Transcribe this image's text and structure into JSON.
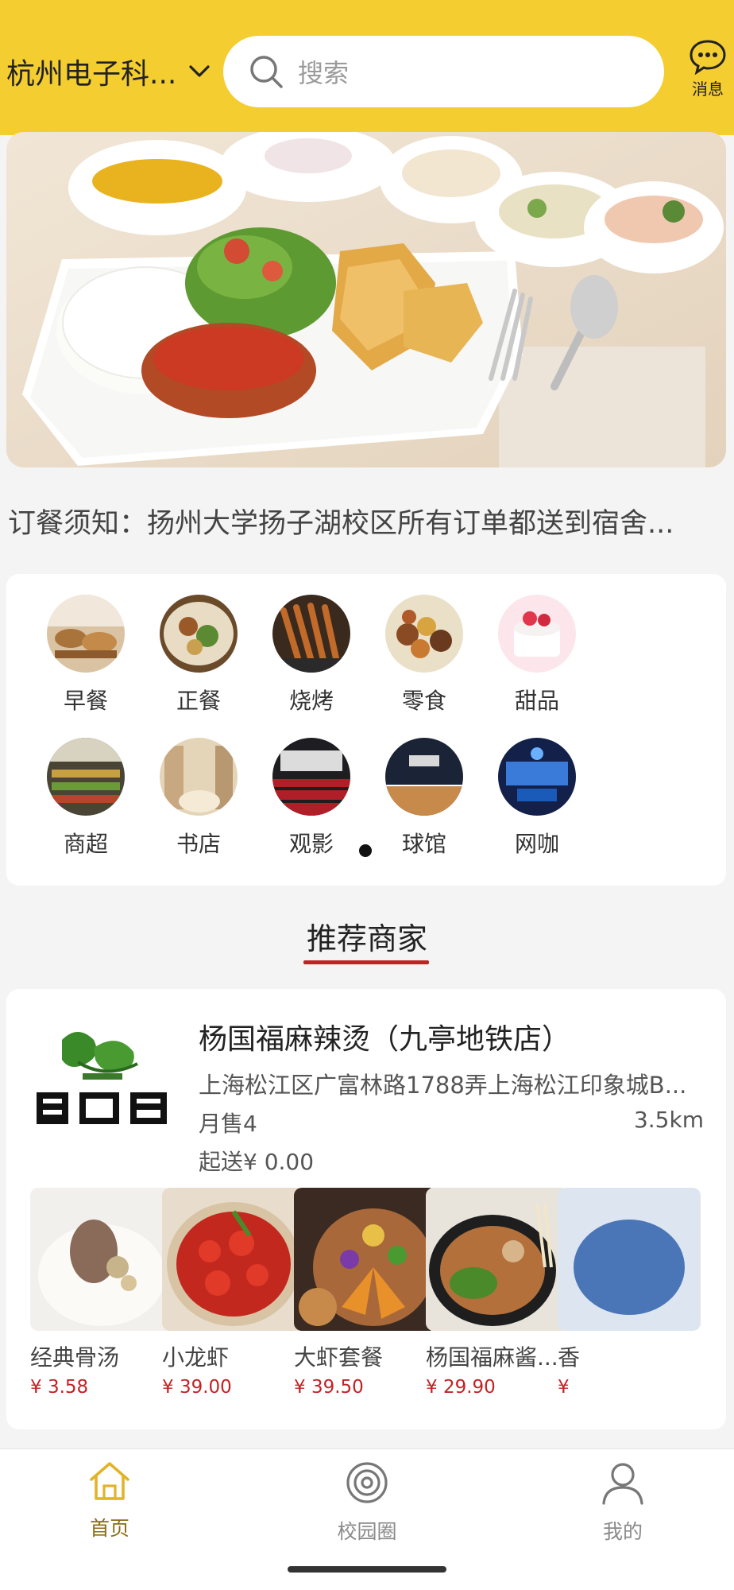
{
  "header": {
    "location": "杭州电子科...",
    "search_placeholder": "搜索",
    "message_label": "消息",
    "icons": [
      "chevron-down-icon",
      "search-icon",
      "chat-bubble-icon"
    ],
    "color": "#f4cd31"
  },
  "notice": "订餐须知：扬州大学扬子湖校区所有订单都送到宿舍...",
  "categories": [
    {
      "label": "早餐",
      "color": "#c89a68"
    },
    {
      "label": "正餐",
      "color": "#8c6a3e"
    },
    {
      "label": "烧烤",
      "color": "#7a4a22"
    },
    {
      "label": "零食",
      "color": "#b8883c"
    },
    {
      "label": "甜品",
      "color": "#f1b7c4"
    },
    {
      "label": "商超",
      "color": "#5a5a4a"
    },
    {
      "label": "书店",
      "color": "#d8c6a6"
    },
    {
      "label": "观影",
      "color": "#8a1c22"
    },
    {
      "label": "球馆",
      "color": "#2a3a56"
    },
    {
      "label": "网咖",
      "color": "#2a5aa8"
    }
  ],
  "section_title": "推荐商家",
  "shop": {
    "name": "杨国福麻辣烫（九亭地铁店）",
    "address": "上海松江区广富林路1788弄上海松江印象城B...",
    "sales": "月售4",
    "distance": "3.5km",
    "min_order": "起送¥ 0.00",
    "dishes": [
      {
        "name": "经典骨汤",
        "price": "¥ 3.58"
      },
      {
        "name": "小龙虾",
        "price": "¥ 39.00"
      },
      {
        "name": "大虾套餐",
        "price": "¥ 39.50"
      },
      {
        "name": "杨国福麻酱...",
        "price": "¥ 29.90"
      },
      {
        "name": "香",
        "price": "¥"
      }
    ]
  },
  "tabbar": {
    "home": "首页",
    "campus": "校园圈",
    "mine": "我的"
  },
  "accent_color": "#c32224"
}
